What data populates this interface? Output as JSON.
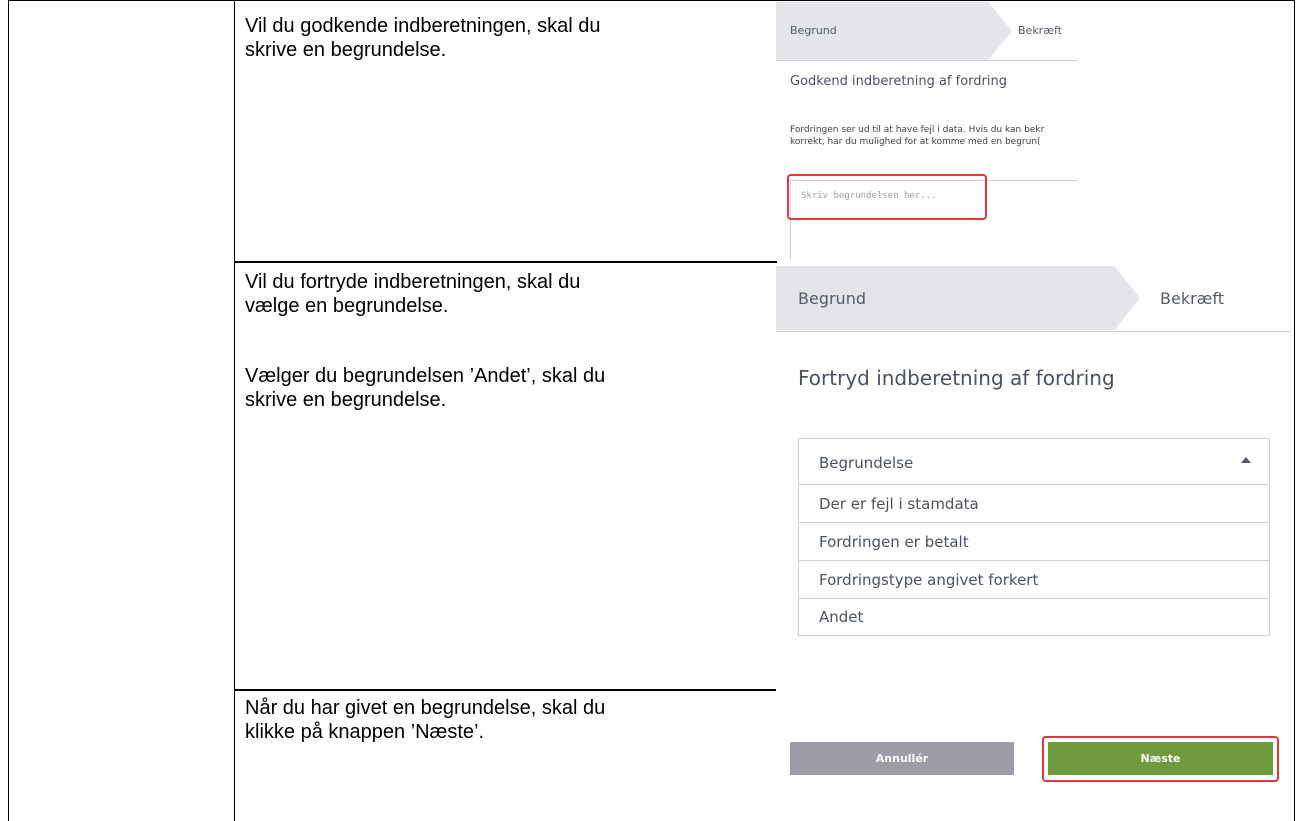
{
  "rows": [
    {
      "instructions": [
        "Vil du godkende indberetningen, skal du",
        "skrive en begrundelse."
      ],
      "screenshot": {
        "steps": [
          "Begrund",
          "Bekræft"
        ],
        "title": "Godkend indberetning af fordring",
        "description_lines": [
          "Fordringen ser ud til at have fejl i data. Hvis du kan bekr",
          "korrekt, har du mulighed for at komme med en begrun("
        ],
        "textarea_placeholder": "Skriv begrundelsen her..."
      }
    },
    {
      "instructions": [
        "Vil du fortryde indberetningen, skal du",
        "vælge en begrundelse."
      ],
      "instructions_2": [
        "Vælger du begrundelsen ’Andet’, skal du",
        "skrive en begrundelse."
      ],
      "screenshot": {
        "steps": [
          "Begrund",
          "Bekræft"
        ],
        "title": "Fortryd indberetning af fordring",
        "dropdown_label": "Begrundelse",
        "dropdown_options": [
          "Der er fejl i stamdata",
          "Fordringen er betalt",
          "Fordringstype angivet forkert",
          "Andet"
        ]
      }
    },
    {
      "instructions": [
        "Når du har givet en begrundelse, skal du",
        "klikke på knappen ’Næste’."
      ],
      "screenshot": {
        "cancel_label": "Annullér",
        "next_label": "Næste",
        "next_color": "#6f9a3e",
        "cancel_color": "#9c9da8"
      }
    }
  ],
  "colors": {
    "highlight": "#e2373b"
  }
}
